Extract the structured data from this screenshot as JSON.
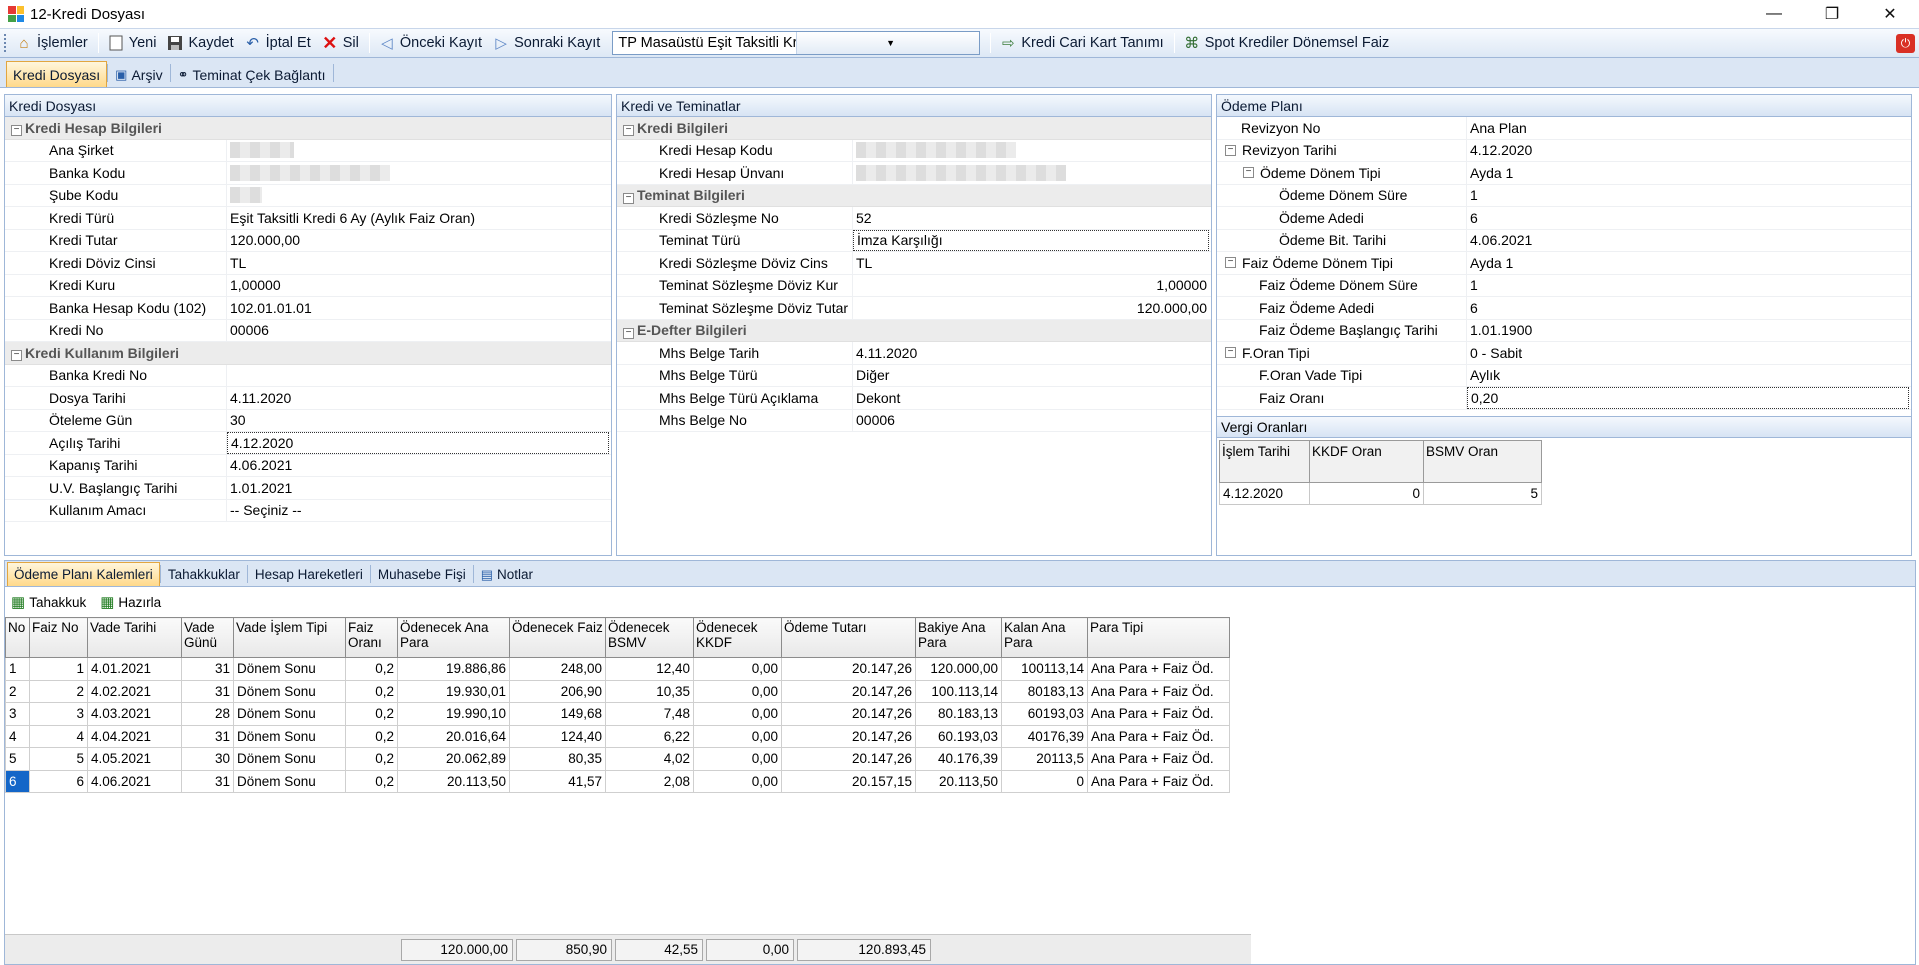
{
  "window": {
    "title": "12-Kredi Dosyası",
    "minimize": "—",
    "maximize": "❐",
    "close": "✕"
  },
  "toolbar": {
    "islemler": "İşlemler",
    "yeni": "Yeni",
    "kaydet": "Kaydet",
    "iptal": "İptal Et",
    "sil": "Sil",
    "onceki": "Önceki Kayıt",
    "sonraki": "Sonraki Kayıt",
    "combo_value": "TP Masaüstü Eşit Taksitli Kredi",
    "cari_kart": "Kredi Cari Kart Tanımı",
    "spot": "Spot Krediler Dönemsel Faiz"
  },
  "tabs": [
    "Kredi Dosyası",
    "Arşiv",
    "Teminat Çek Bağlantı"
  ],
  "panel1": {
    "title": "Kredi Dosyası",
    "cat1": "Kredi Hesap Bilgileri",
    "rows1": [
      {
        "label": "Ana Şirket",
        "value": ""
      },
      {
        "label": "Banka Kodu",
        "value": ""
      },
      {
        "label": "Şube Kodu",
        "value": ""
      },
      {
        "label": "Kredi Türü",
        "value": "Eşit Taksitli Kredi 6 Ay (Aylık Faiz Oran)"
      },
      {
        "label": "Kredi Tutar",
        "value": "120.000,00"
      },
      {
        "label": "Kredi Döviz Cinsi",
        "value": "TL"
      },
      {
        "label": "Kredi Kuru",
        "value": "1,00000"
      },
      {
        "label": "Banka Hesap Kodu (102)",
        "value": "102.01.01.01"
      },
      {
        "label": "Kredi No",
        "value": "00006"
      }
    ],
    "cat2": "Kredi Kullanım Bilgileri",
    "rows2": [
      {
        "label": "Banka Kredi No",
        "value": ""
      },
      {
        "label": "Dosya Tarihi",
        "value": "4.11.2020"
      },
      {
        "label": "Öteleme Gün",
        "value": "30"
      },
      {
        "label": "Açılış Tarihi",
        "value": "4.12.2020"
      },
      {
        "label": "Kapanış Tarihi",
        "value": "4.06.2021"
      },
      {
        "label": "U.V. Başlangıç Tarihi",
        "value": "1.01.2021"
      },
      {
        "label": "Kullanım Amacı",
        "value": "-- Seçiniz --"
      }
    ]
  },
  "panel2": {
    "title": "Kredi ve Teminatlar",
    "cat1": "Kredi Bilgileri",
    "rows1": [
      {
        "label": "Kredi Hesap Kodu",
        "value": ""
      },
      {
        "label": "Kredi Hesap Ünvanı",
        "value": ""
      }
    ],
    "cat2": "Teminat Bilgileri",
    "rows2": [
      {
        "label": "Kredi Sözleşme No",
        "value": "52"
      },
      {
        "label": "Teminat Türü",
        "value": "İmza Karşılığı"
      },
      {
        "label": "Kredi Sözleşme Döviz Cins",
        "value": "TL"
      },
      {
        "label": "Teminat Sözleşme Döviz Kur",
        "value": "1,00000"
      },
      {
        "label": "Teminat Sözleşme Döviz Tutar",
        "value": "120.000,00"
      }
    ],
    "cat3": "E-Defter Bilgileri",
    "rows3": [
      {
        "label": "Mhs Belge Tarih",
        "value": "4.11.2020"
      },
      {
        "label": "Mhs Belge Türü",
        "value": "Diğer"
      },
      {
        "label": "Mhs Belge Türü Açıklama",
        "value": "Dekont"
      },
      {
        "label": "Mhs Belge No",
        "value": "00006"
      }
    ]
  },
  "panel3": {
    "title": "Ödeme Planı",
    "rows": [
      {
        "label": "Revizyon No",
        "value": "Ana Plan"
      },
      {
        "label": "Revizyon Tarihi",
        "value": "4.12.2020"
      },
      {
        "label": "Ödeme Dönem Tipi",
        "value": "Ayda 1"
      },
      {
        "label": "Ödeme Dönem Süre",
        "value": "1"
      },
      {
        "label": "Ödeme Adedi",
        "value": "6"
      },
      {
        "label": "Ödeme Bit. Tarihi",
        "value": "4.06.2021"
      },
      {
        "label": "Faiz Ödeme Dönem Tipi",
        "value": "Ayda 1"
      },
      {
        "label": "Faiz Ödeme Dönem Süre",
        "value": "1"
      },
      {
        "label": "Faiz Ödeme Adedi",
        "value": "6"
      },
      {
        "label": "Faiz Ödeme Başlangıç Tarihi",
        "value": "1.01.1900"
      },
      {
        "label": "F.Oran Tipi",
        "value": "0 - Sabit"
      },
      {
        "label": "F.Oran Vade Tipi",
        "value": "Aylık"
      },
      {
        "label": "Faiz Oranı",
        "value": "0,20"
      }
    ],
    "tax_title": "Vergi Oranları",
    "tax_headers": [
      "İşlem Tarihi",
      "KKDF Oran",
      "BSMV Oran"
    ],
    "tax_row": [
      "4.12.2020",
      "0",
      "5"
    ]
  },
  "bottom": {
    "tabs": [
      "Ödeme Planı Kalemleri",
      "Tahakkuklar",
      "Hesap Hareketleri",
      "Muhasebe Fişi",
      "Notlar"
    ],
    "actions": [
      "Tahakkuk",
      "Hazırla"
    ],
    "headers": [
      "No",
      "Faiz No",
      "Vade Tarihi",
      "Vade Günü",
      "Vade İşlem Tipi",
      "Faiz Oranı",
      "Ödenecek Ana Para",
      "Ödenecek Faiz",
      "Ödenecek BSMV",
      "Ödenecek KKDF",
      "Ödeme Tutarı",
      "Bakiye Ana Para",
      "Kalan Ana Para",
      "Para Tipi"
    ],
    "rows": [
      [
        "1",
        "1",
        "4.01.2021",
        "31",
        "Dönem Sonu",
        "0,2",
        "19.886,86",
        "248,00",
        "12,40",
        "0,00",
        "20.147,26",
        "120.000,00",
        "100113,14",
        "Ana Para + Faiz Öd."
      ],
      [
        "2",
        "2",
        "4.02.2021",
        "31",
        "Dönem Sonu",
        "0,2",
        "19.930,01",
        "206,90",
        "10,35",
        "0,00",
        "20.147,26",
        "100.113,14",
        "80183,13",
        "Ana Para + Faiz Öd."
      ],
      [
        "3",
        "3",
        "4.03.2021",
        "28",
        "Dönem Sonu",
        "0,2",
        "19.990,10",
        "149,68",
        "7,48",
        "0,00",
        "20.147,26",
        "80.183,13",
        "60193,03",
        "Ana Para + Faiz Öd."
      ],
      [
        "4",
        "4",
        "4.04.2021",
        "31",
        "Dönem Sonu",
        "0,2",
        "20.016,64",
        "124,40",
        "6,22",
        "0,00",
        "20.147,26",
        "60.193,03",
        "40176,39",
        "Ana Para + Faiz Öd."
      ],
      [
        "5",
        "5",
        "4.05.2021",
        "30",
        "Dönem Sonu",
        "0,2",
        "20.062,89",
        "80,35",
        "4,02",
        "0,00",
        "20.147,26",
        "40.176,39",
        "20113,5",
        "Ana Para + Faiz Öd."
      ],
      [
        "6",
        "6",
        "4.06.2021",
        "31",
        "Dönem Sonu",
        "0,2",
        "20.113,50",
        "41,57",
        "2,08",
        "0,00",
        "20.157,15",
        "20.113,50",
        "0",
        "Ana Para + Faiz Öd."
      ]
    ],
    "totals": [
      "120.000,00",
      "850,90",
      "42,55",
      "0,00",
      "120.893,45"
    ]
  }
}
